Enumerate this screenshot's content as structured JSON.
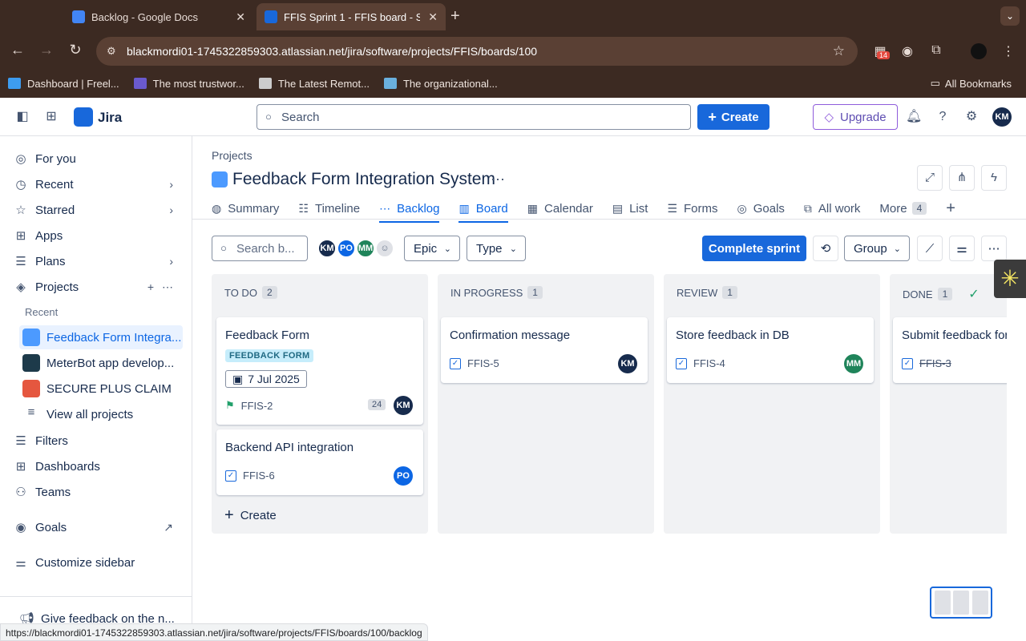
{
  "browser": {
    "tabs": [
      {
        "title": "Backlog - Google Docs",
        "close": "✕"
      },
      {
        "title": "FFIS Sprint 1 - FFIS board - S",
        "close": "✕"
      }
    ],
    "new_tab": "+",
    "url": "blackmordi01-1745322859303.atlassian.net/jira/software/projects/FFIS/boards/100",
    "extension_badge": "14",
    "bookmarks": [
      "Dashboard | Freel...",
      "The most trustwor...",
      "The Latest Remot...",
      "The organizational..."
    ],
    "all_bookmarks": "All Bookmarks",
    "status_url": "https://blackmordi01-1745322859303.atlassian.net/jira/software/projects/FFIS/boards/100/backlog"
  },
  "topbar": {
    "app_name": "Jira",
    "search_placeholder": "Search",
    "create_label": "Create",
    "upgrade_label": "Upgrade",
    "user_initials": "KM"
  },
  "sidebar": {
    "items": [
      {
        "label": "For you"
      },
      {
        "label": "Recent"
      },
      {
        "label": "Starred"
      },
      {
        "label": "Apps"
      },
      {
        "label": "Plans"
      },
      {
        "label": "Projects"
      }
    ],
    "recent_heading": "Recent",
    "projects": [
      {
        "label": "Feedback Form Integra..."
      },
      {
        "label": "MeterBot app develop..."
      },
      {
        "label": "SECURE PLUS CLAIM"
      }
    ],
    "view_all": "View all projects",
    "lower": [
      {
        "label": "Filters"
      },
      {
        "label": "Dashboards"
      },
      {
        "label": "Teams"
      },
      {
        "label": "Goals"
      },
      {
        "label": "Customize sidebar"
      }
    ],
    "feedback": "Give feedback on the n..."
  },
  "page": {
    "breadcrumb": "Projects",
    "title": "Feedback Form Integration System",
    "tabs": [
      "Summary",
      "Timeline",
      "Backlog",
      "Board",
      "Calendar",
      "List",
      "Forms",
      "Goals",
      "All work",
      "More"
    ],
    "more_count": "4"
  },
  "toolbar": {
    "search_placeholder": "Search b...",
    "avatars": [
      "KM",
      "PO",
      "MM"
    ],
    "epic": "Epic",
    "type": "Type",
    "complete_sprint": "Complete sprint",
    "group": "Group"
  },
  "colors": {
    "accent": "#1868db",
    "km": "#172b4d",
    "po": "#0c66e4",
    "mm": "#1f845a",
    "done_check": "#22a06b"
  },
  "columns": [
    {
      "name": "TO DO",
      "count": "2"
    },
    {
      "name": "IN PROGRESS",
      "count": "1"
    },
    {
      "name": "REVIEW",
      "count": "1"
    },
    {
      "name": "DONE",
      "count": "1"
    }
  ],
  "cards": {
    "c1": {
      "title": "Feedback Form",
      "label": "FEEDBACK FORM",
      "date": "7 Jul 2025",
      "key": "FFIS-2",
      "points": "24",
      "assignee": "KM"
    },
    "c2": {
      "title": "Backend API integration",
      "key": "FFIS-6",
      "assignee": "PO"
    },
    "c3": {
      "title": "Confirmation message",
      "key": "FFIS-5",
      "assignee": "KM"
    },
    "c4": {
      "title": "Store feedback in DB",
      "key": "FFIS-4",
      "assignee": "MM"
    },
    "c5": {
      "title": "Submit feedback for",
      "key": "FFIS-3"
    }
  },
  "create_issue": "Create"
}
